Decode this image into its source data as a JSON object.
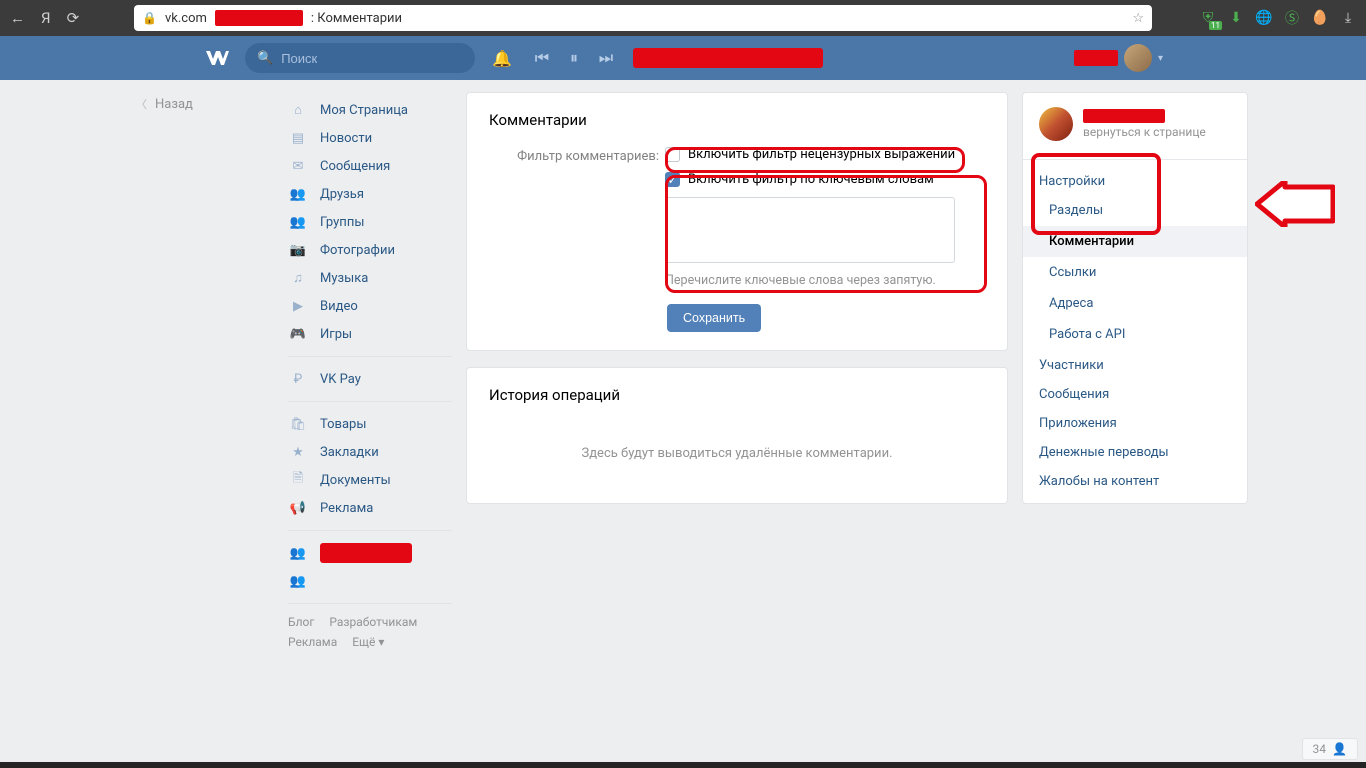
{
  "browser": {
    "url_host": "vk.com",
    "title_suffix": ": Комментарии"
  },
  "header": {
    "search_placeholder": "Поиск"
  },
  "back": "Назад",
  "nav": {
    "items": [
      {
        "icon": "home-icon",
        "glyph": "⌂",
        "label": "Моя Страница"
      },
      {
        "icon": "news-icon",
        "glyph": "▤",
        "label": "Новости"
      },
      {
        "icon": "messages-icon",
        "glyph": "✉",
        "label": "Сообщения"
      },
      {
        "icon": "friends-icon",
        "glyph": "👥",
        "label": "Друзья"
      },
      {
        "icon": "groups-icon",
        "glyph": "👥",
        "label": "Группы"
      },
      {
        "icon": "photos-icon",
        "glyph": "📷",
        "label": "Фотографии"
      },
      {
        "icon": "music-icon",
        "glyph": "♫",
        "label": "Музыка"
      },
      {
        "icon": "video-icon",
        "glyph": "▶",
        "label": "Видео"
      },
      {
        "icon": "games-icon",
        "glyph": "🎮",
        "label": "Игры"
      }
    ],
    "pay": {
      "icon": "pay-icon",
      "glyph": "₽",
      "label": "VK Pay"
    },
    "more": [
      {
        "icon": "market-icon",
        "glyph": "🛍",
        "label": "Товары"
      },
      {
        "icon": "bookmarks-icon",
        "glyph": "★",
        "label": "Закладки"
      },
      {
        "icon": "docs-icon",
        "glyph": "🗎",
        "label": "Документы"
      },
      {
        "icon": "ads-icon",
        "glyph": "📢",
        "label": "Реклама"
      }
    ],
    "footer": [
      "Блог",
      "Разработчикам",
      "Реклама",
      "Ещё ▾"
    ]
  },
  "main": {
    "title": "Комментарии",
    "filter_label": "Фильтр комментариев:",
    "chk_profanity": "Включить фильтр нецензурных выражений",
    "chk_keywords": "Включить фильтр по ключевым словам",
    "kw_hint": "Перечислите ключевые слова через запятую.",
    "save": "Сохранить",
    "history_title": "История операций",
    "history_empty": "Здесь будут выводиться удалённые комментарии."
  },
  "side": {
    "return": "вернуться к странице",
    "settings": "Настройки",
    "sections": "Разделы",
    "comments": "Комментарии",
    "links": "Ссылки",
    "addresses": "Адреса",
    "api": "Работа с API",
    "members": "Участники",
    "messages": "Сообщения",
    "apps": "Приложения",
    "transfers": "Денежные переводы",
    "complaints": "Жалобы на контент"
  },
  "status_count": "34"
}
